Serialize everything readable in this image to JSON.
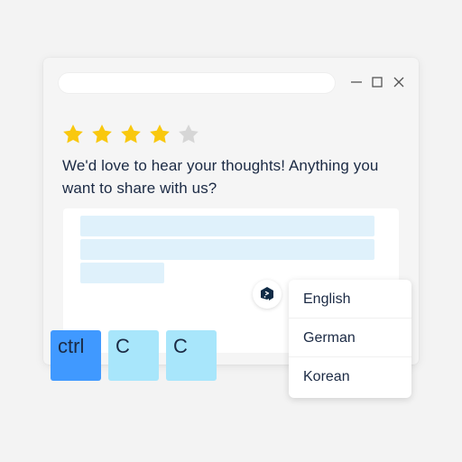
{
  "window": {
    "address_value": "",
    "controls": [
      "minimize-icon",
      "maximize-icon",
      "close-icon"
    ]
  },
  "rating": {
    "value": 4,
    "max": 5,
    "filled_color": "#f9c80e",
    "empty_color": "#d6d6d6"
  },
  "prompt": {
    "text": "We'd love to hear your thoughts! Anything you want to share with us?"
  },
  "feedback": {
    "selected_line_count": 3,
    "highlight_color": "#dff1fb"
  },
  "translator": {
    "icon": "translate-logo-icon"
  },
  "language_menu": {
    "items": [
      "English",
      "German",
      "Korean"
    ]
  },
  "keys": {
    "ctrl": "ctrl",
    "c1": "C",
    "c2": "C",
    "ctrl_color": "#4099ff",
    "key_color": "#a8e6fb"
  }
}
